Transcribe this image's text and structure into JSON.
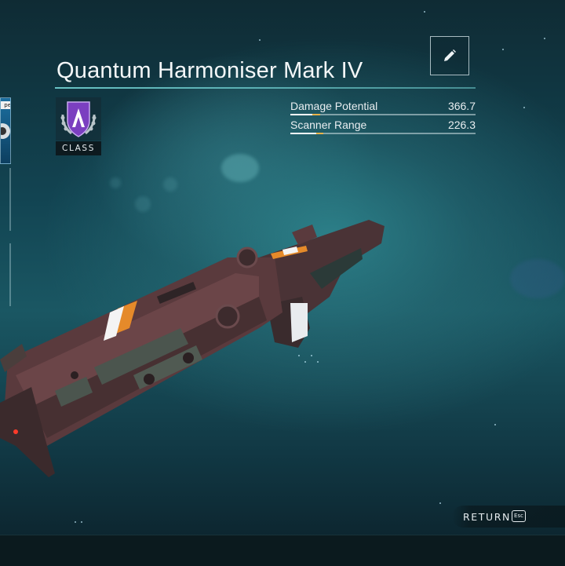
{
  "item": {
    "name": "Quantum Harmoniser Mark IV",
    "class_label": "CLASS",
    "class_grade": "A",
    "class_color": "#7b3fc0"
  },
  "stats": [
    {
      "label": "Damage Potential",
      "value": "366.7",
      "fill": 0.12
    },
    {
      "label": "Scanner Range",
      "value": "226.3",
      "fill": 0.14
    }
  ],
  "controls": {
    "edit_icon": "pencil-icon",
    "return_label": "RETURN",
    "return_key": "Esc"
  },
  "left_panel": {
    "card_tag": "pe"
  },
  "colors": {
    "accent_line": "#78dcdc",
    "stat_accent": "#e8b34a",
    "weapon_body": "#5a3a3d",
    "weapon_stripe": "#e58a2a"
  }
}
